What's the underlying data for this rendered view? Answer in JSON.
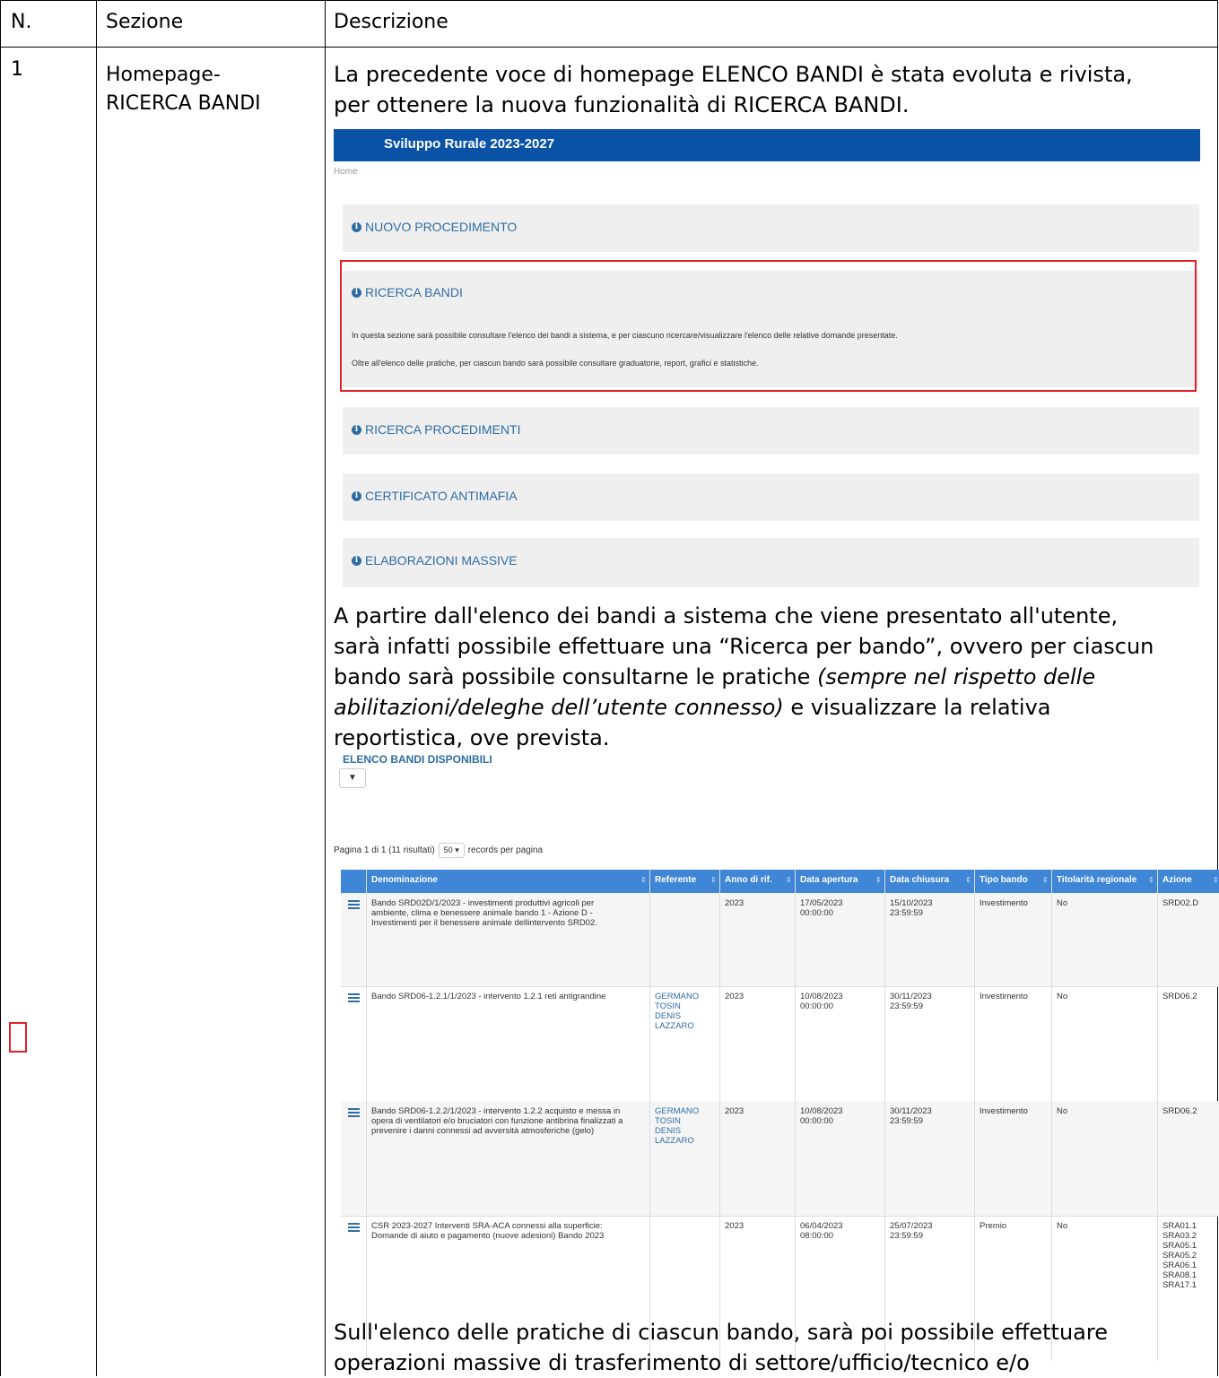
{
  "header": {
    "n": "N.",
    "sezione": "Sezione",
    "descrizione": "Descrizione"
  },
  "row": {
    "number": "1",
    "section_line1": "Homepage-",
    "section_line2": "RICERCA BANDI",
    "intro_line1": "La precedente voce di homepage ELENCO BANDI è stata evoluta e rivista,",
    "intro_line2": "per ottenere la nuova funzionalità di RICERCA BANDI.",
    "para2": {
      "l1": "A partire dall'elenco dei bandi a sistema che viene presentato all'utente,",
      "l2": "sarà infatti possibile effettuare una “Ricerca per bando”, ovvero per ciascun",
      "l3a": "bando sarà possibile consultarne le pratiche ",
      "l3b": "(sempre nel rispetto delle",
      "l4a": "abilitazioni/deleghe dell’utente connesso)",
      "l4b": " e visualizzare la relativa",
      "l5": "reportistica, ove prevista."
    },
    "para3": {
      "l1": "Sull'elenco delle pratiche di ciascun bando, sarà poi possibile effettuare",
      "l2": "operazioni massive di trasferimento di settore/ufficio/tecnico e/o"
    }
  },
  "screenshot1": {
    "app_title": "Sviluppo Rurale 2023-2027",
    "breadcrumb": "Home",
    "panels": [
      {
        "title": "NUOVO PROCEDIMENTO"
      },
      {
        "title": "RICERCA BANDI",
        "note1": "In questa sezione sarà possibile consultare l'elenco dei bandi a sistema, e per ciascuno ricercare/visualizzare l'elenco delle relative domande presentate.",
        "note2": "Oltre all'elenco delle pratiche, per ciascun bando sarà possibile consultare graduatorie, report, grafici e statistiche."
      },
      {
        "title": "RICERCA PROCEDIMENTI"
      },
      {
        "title": "CERTIFICATO ANTIMAFIA"
      },
      {
        "title": "ELABORAZIONI MASSIVE"
      }
    ]
  },
  "screenshot2": {
    "title": "ELENCO BANDI DISPONIBILI",
    "filter_icon": "filter-icon",
    "pagination_text": "Pagina 1 di 1 (11 risultati)",
    "page_size": "50",
    "page_size_suffix": "records per pagina",
    "columns": [
      "Denominazione",
      "Referente",
      "Anno di rif.",
      "Data apertura",
      "Data chiusura",
      "Tipo bando",
      "Titolarità regionale",
      "Azione"
    ],
    "rows": [
      {
        "den": [
          "Bando SRD02D/1/2023 - investimenti produttivi agricoli per",
          "ambiente, clima e benessere animale bando 1 - Azione D -",
          "Investimenti per il benessere animale dellintervento SRD02."
        ],
        "ref": [],
        "anno": "2023",
        "apertura": [
          "17/05/2023",
          "00:00:00"
        ],
        "chiusura": [
          "15/10/2023",
          "23:59:59"
        ],
        "tipo": "Investimento",
        "tit": "No",
        "azione": [
          "SRD02.D"
        ]
      },
      {
        "den": [
          "Bando SRD06-1.2.1/1/2023 - intervento 1.2.1 reti antigrandine"
        ],
        "ref": [
          "GERMANO",
          "TOSIN",
          "DENIS",
          "LAZZARO"
        ],
        "anno": "2023",
        "apertura": [
          "10/08/2023",
          "00:00:00"
        ],
        "chiusura": [
          "30/11/2023",
          "23:59:59"
        ],
        "tipo": "Investimento",
        "tit": "No",
        "azione": [
          "SRD06.2"
        ]
      },
      {
        "den": [
          "Bando SRD06-1.2.2/1/2023 - intervento 1.2.2 acquisto e messa in",
          "opera di ventilatori e/o bruciatori con funzione antibrina finalizzati a",
          "prevenire i danni connessi ad avversità atmosferiche (gelo)"
        ],
        "ref": [
          "GERMANO",
          "TOSIN",
          "DENIS",
          "LAZZARO"
        ],
        "anno": "2023",
        "apertura": [
          "10/08/2023",
          "00:00:00"
        ],
        "chiusura": [
          "30/11/2023",
          "23:59:59"
        ],
        "tipo": "Investimento",
        "tit": "No",
        "azione": [
          "SRD06.2"
        ]
      },
      {
        "den": [
          "CSR 2023-2027 Interventi SRA-ACA connessi alla superficie:",
          "Domande di aiuto e pagamento (nuove adesioni) Bando 2023"
        ],
        "ref": [],
        "anno": "2023",
        "apertura": [
          "06/04/2023",
          "08:00:00"
        ],
        "chiusura": [
          "25/07/2023",
          "23:59:59"
        ],
        "tipo": "Premio",
        "tit": "No",
        "azione": [
          "SRA01.1",
          "SRA03.2",
          "SRA05.1",
          "SRA05.2",
          "SRA06.1",
          "SRA08.1",
          "SRA17.1"
        ]
      }
    ]
  }
}
